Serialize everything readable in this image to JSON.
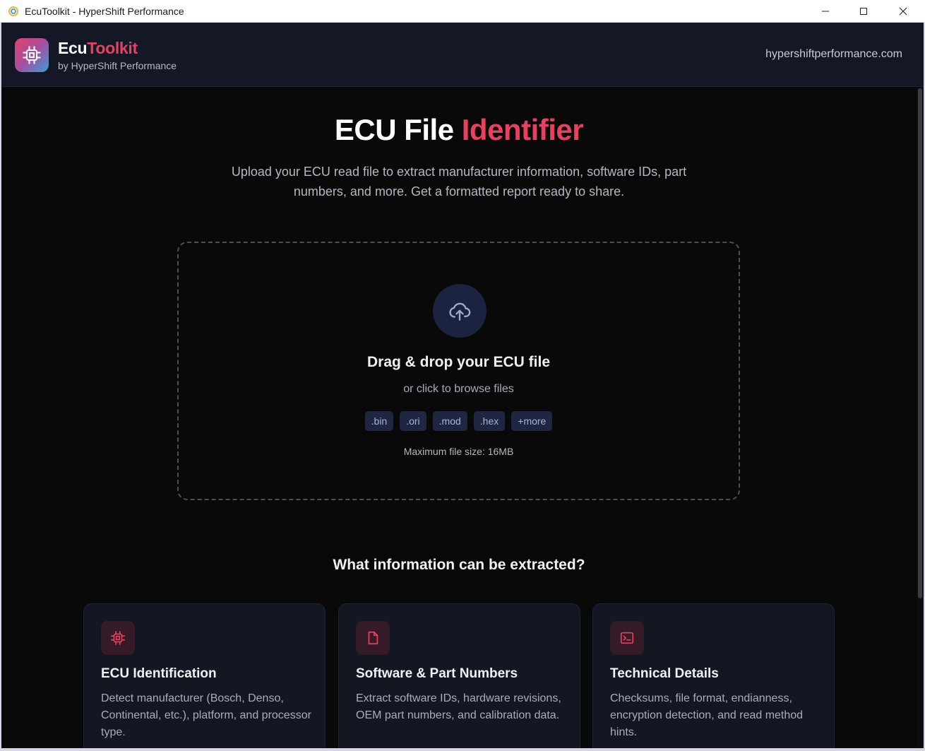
{
  "window": {
    "title": "EcuToolkit - HyperShift Performance"
  },
  "header": {
    "brand_part1": "Ecu",
    "brand_part2": "Toolkit",
    "subtitle": "by HyperShift Performance",
    "site_link": "hypershiftperformance.com"
  },
  "hero": {
    "title_part1": "ECU File ",
    "title_part2": "Identifier",
    "description": "Upload your ECU read file to extract manufacturer information, software IDs, part numbers, and more. Get a formatted report ready to share."
  },
  "dropzone": {
    "icon": "cloud-upload-icon",
    "title": "Drag & drop your ECU file",
    "subtitle": "or click to browse files",
    "extensions": [
      ".bin",
      ".ori",
      ".mod",
      ".hex",
      "+more"
    ],
    "max_size": "Maximum file size: 16MB"
  },
  "features": {
    "heading": "What information can be extracted?",
    "cards": [
      {
        "icon": "cpu-chip-icon",
        "title": "ECU Identification",
        "text": "Detect manufacturer (Bosch, Denso, Continental, etc.), platform, and processor type."
      },
      {
        "icon": "file-icon",
        "title": "Software & Part Numbers",
        "text": "Extract software IDs, hardware revisions, OEM part numbers, and calibration data."
      },
      {
        "icon": "terminal-icon",
        "title": "Technical Details",
        "text": "Checksums, file format, endianness, encryption detection, and read method hints."
      }
    ]
  },
  "colors": {
    "accent": "#e8405e",
    "background": "#090909",
    "header_bg": "#131726",
    "card_bg": "#131722",
    "chip_bg": "#1e2642"
  }
}
